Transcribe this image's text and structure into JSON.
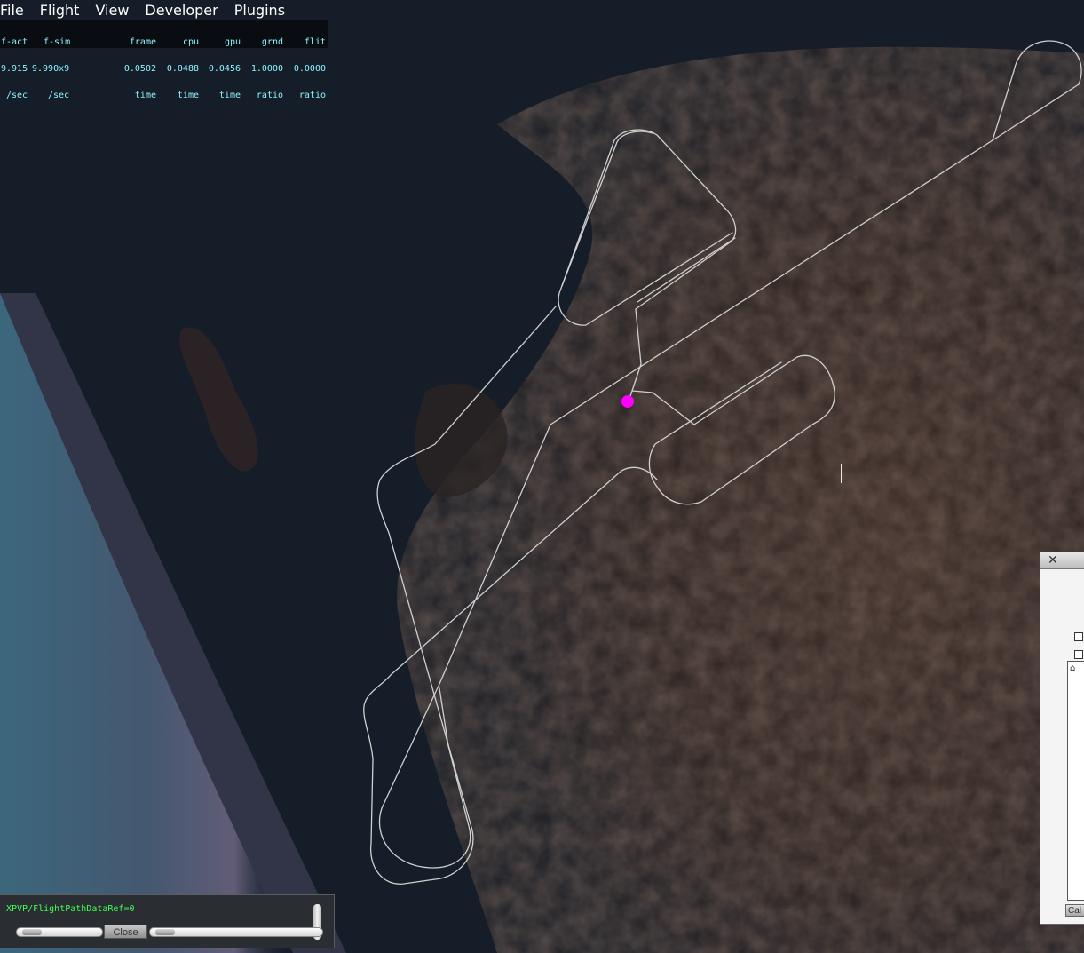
{
  "menu": {
    "items": [
      "File",
      "Flight",
      "View",
      "Developer",
      "Plugins"
    ]
  },
  "stats": {
    "columns": [
      [
        "f-act",
        "9.915",
        "/sec"
      ],
      [
        "f-sim",
        "9.990x9",
        "/sec"
      ],
      [
        "frame",
        "0.0502",
        "time"
      ],
      [
        "cpu",
        "0.0488",
        "time"
      ],
      [
        "gpu",
        "0.0456",
        "time"
      ],
      [
        "grnd",
        "1.0000",
        "ratio"
      ],
      [
        "flit",
        "0.0000",
        "ratio"
      ]
    ]
  },
  "dataref_panel": {
    "text": "XPVP/FlightPathDataRef=0",
    "close_label": "Close"
  },
  "side_window": {
    "close_glyph": "✕",
    "home_glyph": "⌂",
    "button_label": "Cal"
  },
  "colors": {
    "aircraft_marker": "#ff00ff",
    "flight_path": "#d0d0d0",
    "dataref_text": "#44ff55",
    "stats_text": "#8ff3ff"
  },
  "icons": {
    "aircraft": "aircraft-position-marker",
    "crosshair": "crosshair-icon"
  }
}
